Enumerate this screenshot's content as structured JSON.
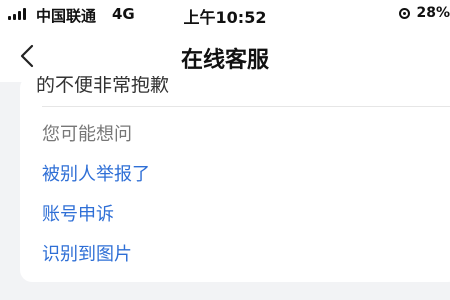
{
  "status_bar": {
    "carrier": "中国联通",
    "network": "4G",
    "time": "上午10:52",
    "battery": "28%"
  },
  "nav": {
    "title": "在线客服"
  },
  "chat": {
    "cut_message": "的不便非常抱歉",
    "suggestions_title": "您可能想问",
    "suggestions": [
      {
        "label": "被别人举报了"
      },
      {
        "label": "账号申诉"
      },
      {
        "label": "识别到图片"
      }
    ]
  },
  "colors": {
    "link": "#2f6fd6",
    "muted": "#777777",
    "background": "#f2f3f5"
  }
}
